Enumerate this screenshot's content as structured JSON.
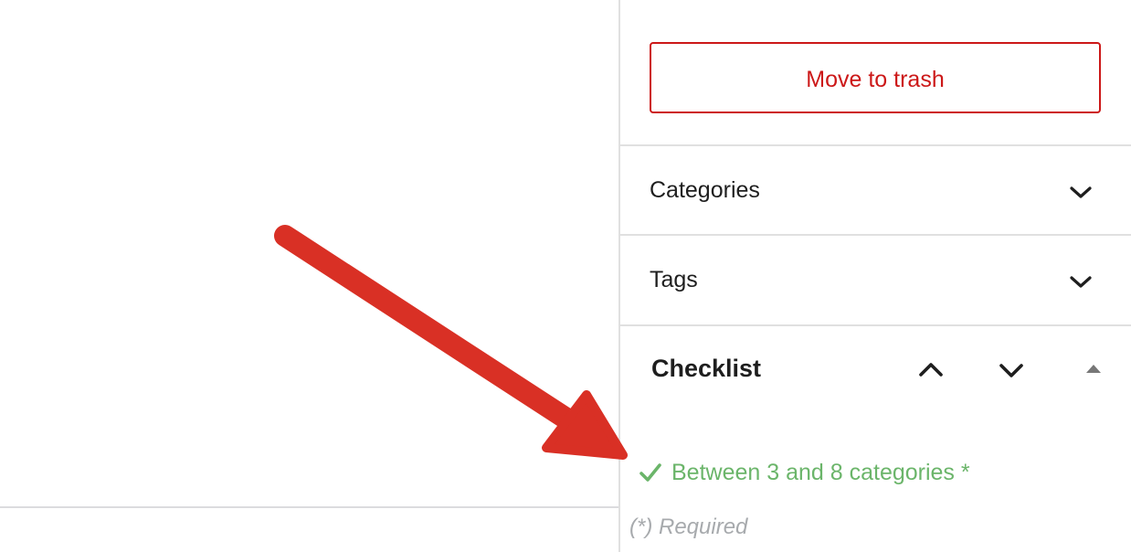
{
  "sidebar": {
    "trash_button_label": "Move to trash",
    "panels": [
      {
        "label": "Categories",
        "icon": "chevron-down-icon"
      },
      {
        "label": "Tags",
        "icon": "chevron-down-icon"
      }
    ],
    "checklist": {
      "title": "Checklist",
      "controls": [
        "move-up-icon",
        "move-down-icon",
        "collapse-triangle-icon"
      ],
      "items": [
        {
          "label": "Between 3 and 8 categories *",
          "status": "passed",
          "icon": "checkmark-icon"
        }
      ],
      "required_note": "(*) Required"
    }
  },
  "annotation": {
    "arrow_color": "#d93025",
    "icon": "red-arrow-icon"
  },
  "colors": {
    "danger": "#cc1818",
    "success": "#6bb56a",
    "muted": "#a7aaad",
    "text": "#1e1e1e",
    "divider": "#e0e0e0"
  }
}
